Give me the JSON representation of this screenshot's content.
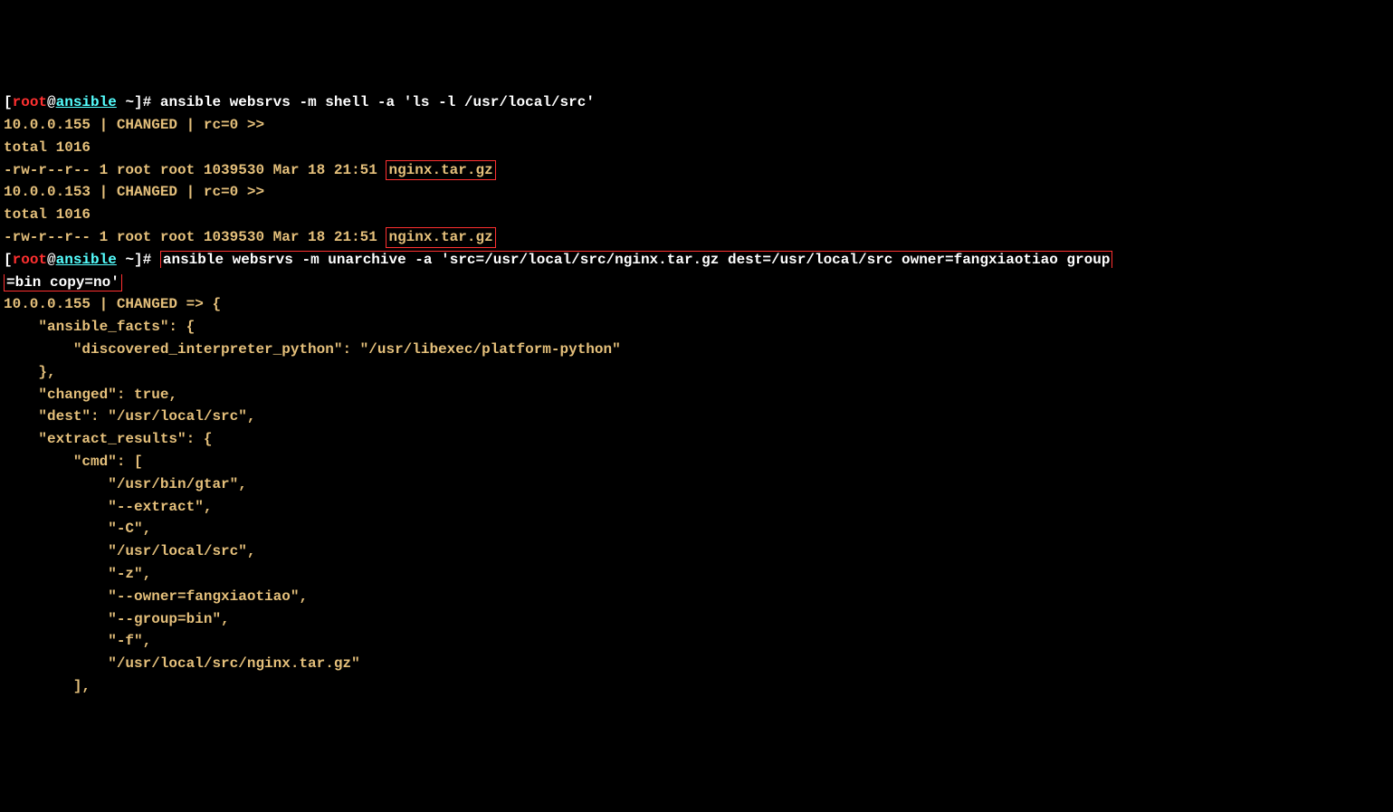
{
  "prompt": {
    "open_bracket": "[",
    "user": "root",
    "at": "@",
    "host": "ansible",
    "space_tilde_close": " ~]",
    "hash": "# "
  },
  "cmd1": "ansible websrvs -m shell -a 'ls -l /usr/local/src'",
  "out1": {
    "host155": "10.0.0.155 | CHANGED | rc=0 >>",
    "total1": "total 1016",
    "ls_prefix1": "-rw-r--r-- 1 root root 1039530 Mar 18 21:51 ",
    "file1": "nginx.tar.gz",
    "host153": "10.0.0.153 | CHANGED | rc=0 >>",
    "total2": "total 1016",
    "ls_prefix2": "-rw-r--r-- 1 root root 1039530 Mar 18 21:51 ",
    "file2": "nginx.tar.gz"
  },
  "cmd2_part1": "ansible websrvs -m unarchive -a 'src=/usr/local/src/nginx.tar.gz dest=/usr/local/src owner=fangxiaotiao group",
  "cmd2_part2": "=bin copy=no'",
  "out2": {
    "l0": "10.0.0.155 | CHANGED => {",
    "l1": "    \"ansible_facts\": {",
    "l2": "        \"discovered_interpreter_python\": \"/usr/libexec/platform-python\"",
    "l3": "    },",
    "l4": "    \"changed\": true,",
    "l5": "    \"dest\": \"/usr/local/src\",",
    "l6": "    \"extract_results\": {",
    "l7": "        \"cmd\": [",
    "l8": "            \"/usr/bin/gtar\",",
    "l9": "            \"--extract\",",
    "l10": "            \"-C\",",
    "l11": "            \"/usr/local/src\",",
    "l12": "            \"-z\",",
    "l13": "            \"--owner=fangxiaotiao\",",
    "l14": "            \"--group=bin\",",
    "l15": "            \"-f\",",
    "l16": "            \"/usr/local/src/nginx.tar.gz\"",
    "l17": "        ],"
  }
}
